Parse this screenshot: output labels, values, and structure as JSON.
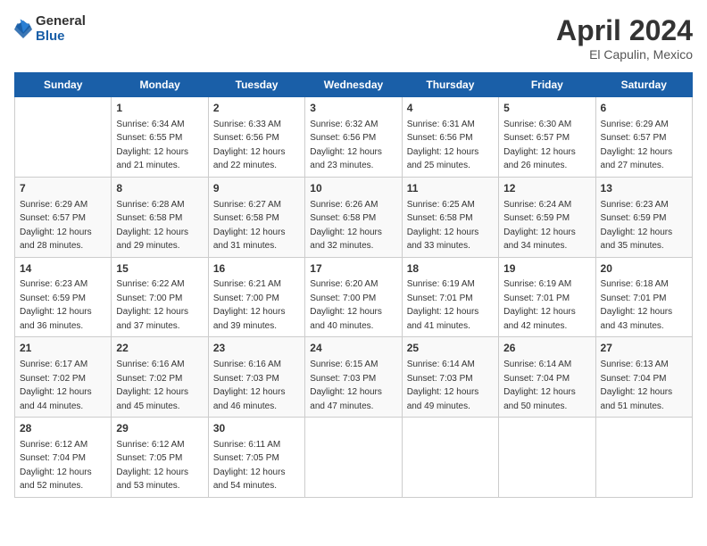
{
  "logo": {
    "general": "General",
    "blue": "Blue"
  },
  "title": "April 2024",
  "subtitle": "El Capulin, Mexico",
  "days_of_week": [
    "Sunday",
    "Monday",
    "Tuesday",
    "Wednesday",
    "Thursday",
    "Friday",
    "Saturday"
  ],
  "weeks": [
    [
      {
        "day": "",
        "info": ""
      },
      {
        "day": "1",
        "info": "Sunrise: 6:34 AM\nSunset: 6:55 PM\nDaylight: 12 hours\nand 21 minutes."
      },
      {
        "day": "2",
        "info": "Sunrise: 6:33 AM\nSunset: 6:56 PM\nDaylight: 12 hours\nand 22 minutes."
      },
      {
        "day": "3",
        "info": "Sunrise: 6:32 AM\nSunset: 6:56 PM\nDaylight: 12 hours\nand 23 minutes."
      },
      {
        "day": "4",
        "info": "Sunrise: 6:31 AM\nSunset: 6:56 PM\nDaylight: 12 hours\nand 25 minutes."
      },
      {
        "day": "5",
        "info": "Sunrise: 6:30 AM\nSunset: 6:57 PM\nDaylight: 12 hours\nand 26 minutes."
      },
      {
        "day": "6",
        "info": "Sunrise: 6:29 AM\nSunset: 6:57 PM\nDaylight: 12 hours\nand 27 minutes."
      }
    ],
    [
      {
        "day": "7",
        "info": "Sunrise: 6:29 AM\nSunset: 6:57 PM\nDaylight: 12 hours\nand 28 minutes."
      },
      {
        "day": "8",
        "info": "Sunrise: 6:28 AM\nSunset: 6:58 PM\nDaylight: 12 hours\nand 29 minutes."
      },
      {
        "day": "9",
        "info": "Sunrise: 6:27 AM\nSunset: 6:58 PM\nDaylight: 12 hours\nand 31 minutes."
      },
      {
        "day": "10",
        "info": "Sunrise: 6:26 AM\nSunset: 6:58 PM\nDaylight: 12 hours\nand 32 minutes."
      },
      {
        "day": "11",
        "info": "Sunrise: 6:25 AM\nSunset: 6:58 PM\nDaylight: 12 hours\nand 33 minutes."
      },
      {
        "day": "12",
        "info": "Sunrise: 6:24 AM\nSunset: 6:59 PM\nDaylight: 12 hours\nand 34 minutes."
      },
      {
        "day": "13",
        "info": "Sunrise: 6:23 AM\nSunset: 6:59 PM\nDaylight: 12 hours\nand 35 minutes."
      }
    ],
    [
      {
        "day": "14",
        "info": "Sunrise: 6:23 AM\nSunset: 6:59 PM\nDaylight: 12 hours\nand 36 minutes."
      },
      {
        "day": "15",
        "info": "Sunrise: 6:22 AM\nSunset: 7:00 PM\nDaylight: 12 hours\nand 37 minutes."
      },
      {
        "day": "16",
        "info": "Sunrise: 6:21 AM\nSunset: 7:00 PM\nDaylight: 12 hours\nand 39 minutes."
      },
      {
        "day": "17",
        "info": "Sunrise: 6:20 AM\nSunset: 7:00 PM\nDaylight: 12 hours\nand 40 minutes."
      },
      {
        "day": "18",
        "info": "Sunrise: 6:19 AM\nSunset: 7:01 PM\nDaylight: 12 hours\nand 41 minutes."
      },
      {
        "day": "19",
        "info": "Sunrise: 6:19 AM\nSunset: 7:01 PM\nDaylight: 12 hours\nand 42 minutes."
      },
      {
        "day": "20",
        "info": "Sunrise: 6:18 AM\nSunset: 7:01 PM\nDaylight: 12 hours\nand 43 minutes."
      }
    ],
    [
      {
        "day": "21",
        "info": "Sunrise: 6:17 AM\nSunset: 7:02 PM\nDaylight: 12 hours\nand 44 minutes."
      },
      {
        "day": "22",
        "info": "Sunrise: 6:16 AM\nSunset: 7:02 PM\nDaylight: 12 hours\nand 45 minutes."
      },
      {
        "day": "23",
        "info": "Sunrise: 6:16 AM\nSunset: 7:03 PM\nDaylight: 12 hours\nand 46 minutes."
      },
      {
        "day": "24",
        "info": "Sunrise: 6:15 AM\nSunset: 7:03 PM\nDaylight: 12 hours\nand 47 minutes."
      },
      {
        "day": "25",
        "info": "Sunrise: 6:14 AM\nSunset: 7:03 PM\nDaylight: 12 hours\nand 49 minutes."
      },
      {
        "day": "26",
        "info": "Sunrise: 6:14 AM\nSunset: 7:04 PM\nDaylight: 12 hours\nand 50 minutes."
      },
      {
        "day": "27",
        "info": "Sunrise: 6:13 AM\nSunset: 7:04 PM\nDaylight: 12 hours\nand 51 minutes."
      }
    ],
    [
      {
        "day": "28",
        "info": "Sunrise: 6:12 AM\nSunset: 7:04 PM\nDaylight: 12 hours\nand 52 minutes."
      },
      {
        "day": "29",
        "info": "Sunrise: 6:12 AM\nSunset: 7:05 PM\nDaylight: 12 hours\nand 53 minutes."
      },
      {
        "day": "30",
        "info": "Sunrise: 6:11 AM\nSunset: 7:05 PM\nDaylight: 12 hours\nand 54 minutes."
      },
      {
        "day": "",
        "info": ""
      },
      {
        "day": "",
        "info": ""
      },
      {
        "day": "",
        "info": ""
      },
      {
        "day": "",
        "info": ""
      }
    ]
  ]
}
